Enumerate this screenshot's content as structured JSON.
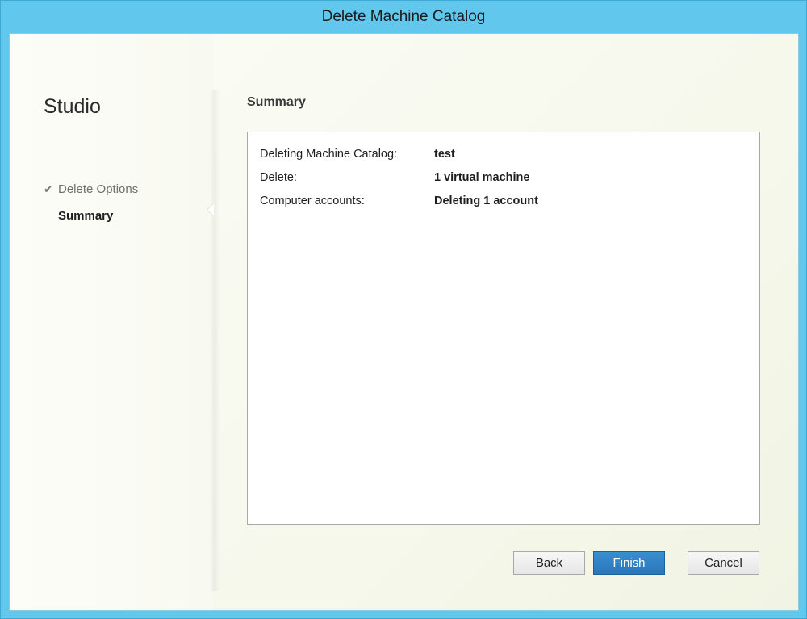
{
  "window": {
    "title": "Delete Machine Catalog"
  },
  "sidebar": {
    "title": "Studio",
    "items": [
      {
        "label": "Delete Options",
        "state": "completed",
        "icon": "checkmark-icon"
      },
      {
        "label": "Summary",
        "state": "active"
      }
    ]
  },
  "main": {
    "section_title": "Summary",
    "summary_rows": [
      {
        "key": "Deleting Machine Catalog:",
        "value": "test"
      },
      {
        "key": "Delete:",
        "value": "1 virtual machine"
      },
      {
        "key": "Computer accounts:",
        "value": "Deleting 1 account"
      }
    ]
  },
  "buttons": {
    "back": "Back",
    "finish": "Finish",
    "cancel": "Cancel"
  },
  "colors": {
    "titlebar": "#62c7ec",
    "primary_button": "#2a76b8",
    "client_background": "#f7f9ee"
  }
}
